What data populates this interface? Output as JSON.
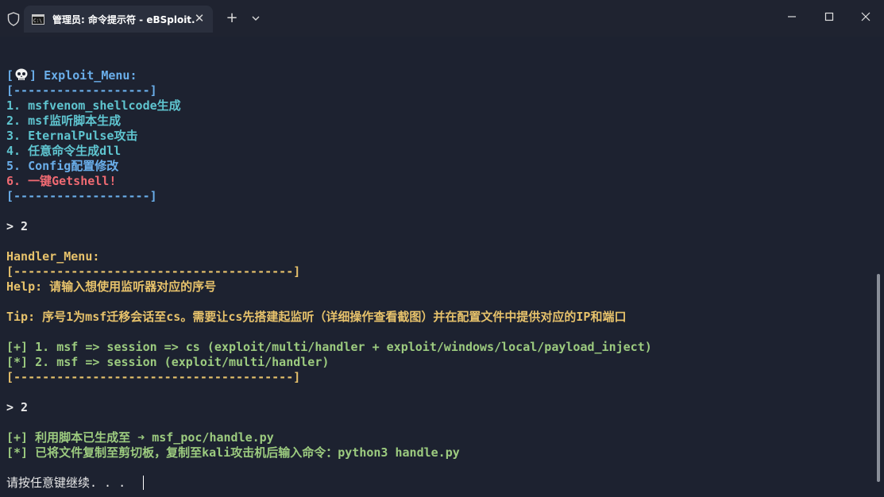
{
  "window": {
    "tab_title": "管理员: 命令提示符 - eBSploit.",
    "tab_close_glyph": "✕",
    "new_tab_glyph": "+",
    "icons": [
      "shield-icon",
      "cmd-icon",
      "close-icon",
      "plus-icon",
      "chevron-down-icon",
      "minimize-icon",
      "maximize-icon",
      "window-close-icon"
    ]
  },
  "terminal": {
    "exploit_menu": {
      "title": "] Exploit_Menu:",
      "bracket_open": "[",
      "border_top": "[-------------------]",
      "items": [
        "1. msfvenom_shellcode生成",
        "2. msf监听脚本生成",
        "3. EternalPulse攻击",
        "4. 任意命令生成dll",
        "5. Config配置修改",
        "6. 一键Getshell!"
      ],
      "border_bottom": "[-------------------]"
    },
    "prompt_1": "> 2",
    "handler_menu": {
      "title": "Handler_Menu:",
      "border_top": "[---------------------------------------]",
      "help": "Help: 请输入想使用监听器对应的序号",
      "tip": "Tip: 序号1为msf迁移会话至cs。需要让cs先搭建起监听（详细操作查看截图）并在配置文件中提供对应的IP和端口",
      "options": [
        "[+] 1. msf => session => cs (exploit/multi/handler + exploit/windows/local/payload_inject)",
        "[*] 2. msf => session (exploit/multi/handler)"
      ],
      "border_bottom": "[---------------------------------------]"
    },
    "prompt_2": "> 2",
    "results": [
      "[+] 利用脚本已生成至 ➜ msf_poc/handle.py",
      "[*] 已将文件复制至剪切板，复制至kali攻击机后输入命令：python3 handle.py"
    ],
    "continue_prompt": "请按任意键继续. . ."
  },
  "colors": {
    "background": "#1d2230",
    "blue": "#6aaeea",
    "cyan": "#5fc5d0",
    "red": "#ef6a72",
    "yellow": "#e7c26b",
    "green": "#9ccb7f"
  }
}
